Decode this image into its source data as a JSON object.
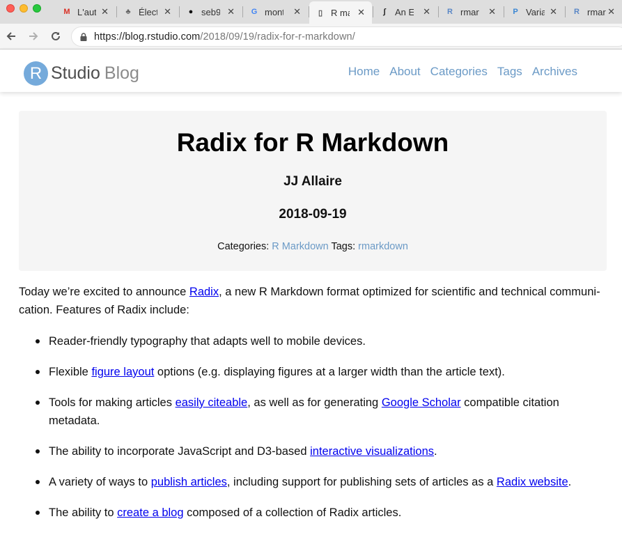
{
  "browser": {
    "tabs": [
      {
        "title": "L'aut",
        "icon": "gmail-icon",
        "glyph": "M",
        "color": "#d93025"
      },
      {
        "title": "Élect",
        "icon": "tree-icon",
        "glyph": "♣",
        "color": "#666666"
      },
      {
        "title": "seb9",
        "icon": "github-icon",
        "glyph": "●",
        "color": "#111111"
      },
      {
        "title": "mont",
        "icon": "google-icon",
        "glyph": "G",
        "color": "#4285f4"
      },
      {
        "title": "R ma",
        "icon": "document-icon",
        "glyph": "▯",
        "color": "#555555"
      },
      {
        "title": "An El",
        "icon": "integral-icon",
        "glyph": "∫",
        "color": "#222222"
      },
      {
        "title": "rmarl",
        "icon": "r-logo-icon",
        "glyph": "R",
        "color": "#5a87c6"
      },
      {
        "title": "Varia",
        "icon": "p-logo-icon",
        "glyph": "P",
        "color": "#3a86d4"
      },
      {
        "title": "rmar",
        "icon": "r-logo-icon",
        "glyph": "R",
        "color": "#5a87c6"
      }
    ],
    "url_host": "https://blog.rstudio.com",
    "url_path": "/2018/09/19/radix-for-r-markdown/"
  },
  "site": {
    "logo_letter": "R",
    "logo_name": "Studio",
    "logo_suffix": "Blog",
    "nav": [
      "Home",
      "About",
      "Categories",
      "Tags",
      "Archives"
    ],
    "accent": "#6b9ac6"
  },
  "post": {
    "title": "Radix for R Markdown",
    "author": "JJ Allaire",
    "date": "2018-09-19",
    "categories_label": "Categories:",
    "category": "R Markdown",
    "tags_label": "Tags:",
    "tag": "rmarkdown"
  },
  "intro": {
    "before": "Today we’re excited to announce ",
    "link": "Radix",
    "after": ", a new R Markdown format optimized for scientific and technical communi-cation. Features of Radix include:"
  },
  "features": [
    {
      "parts": [
        {
          "t": "Reader-friendly typography that adapts well to mobile devices."
        }
      ]
    },
    {
      "parts": [
        {
          "t": "Flexible "
        },
        {
          "t": "figure layout",
          "link": true
        },
        {
          "t": " options (e.g. displaying figures at a larger width than the article text)."
        }
      ]
    },
    {
      "parts": [
        {
          "t": "Tools for making articles "
        },
        {
          "t": "easily citeable",
          "link": true
        },
        {
          "t": ", as well as for generating "
        },
        {
          "t": "Google Scholar",
          "link": true
        },
        {
          "t": " compatible citation metadata."
        }
      ]
    },
    {
      "parts": [
        {
          "t": "The ability to incorporate JavaScript and D3-based "
        },
        {
          "t": "interactive visualizations",
          "link": true
        },
        {
          "t": "."
        }
      ]
    },
    {
      "parts": [
        {
          "t": "A variety of ways to "
        },
        {
          "t": "publish articles",
          "link": true
        },
        {
          "t": ", including support for publishing sets of articles as a "
        },
        {
          "t": "Radix website",
          "link": true
        },
        {
          "t": "."
        }
      ]
    },
    {
      "parts": [
        {
          "t": "The ability to "
        },
        {
          "t": "create a blog",
          "link": true
        },
        {
          "t": " composed of a collection of Radix articles."
        }
      ]
    }
  ]
}
